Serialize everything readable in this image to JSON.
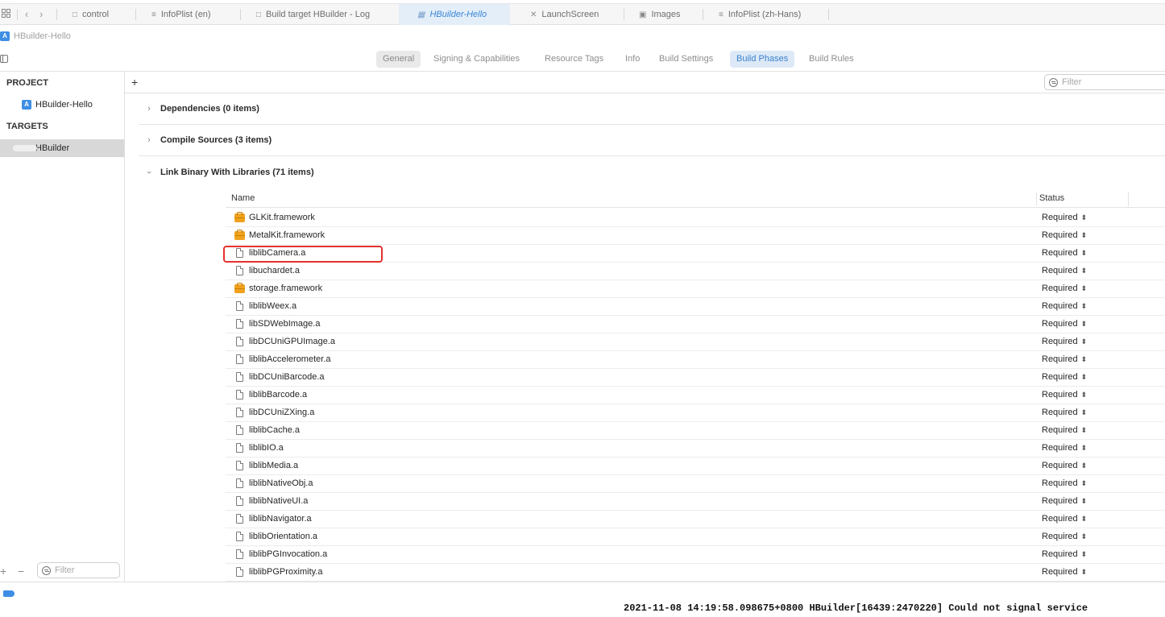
{
  "tabs": [
    {
      "label": "control",
      "icon": "file-icon"
    },
    {
      "label": "InfoPlist (en)",
      "icon": "strings-icon"
    },
    {
      "label": "Build target HBuilder - Log",
      "icon": "file-icon"
    },
    {
      "label": "HBuilder-Hello",
      "icon": "app-icon",
      "active": true
    },
    {
      "label": "LaunchScreen",
      "icon": "storyboard-icon"
    },
    {
      "label": "Images",
      "icon": "image-icon"
    },
    {
      "label": "InfoPlist (zh-Hans)",
      "icon": "strings-icon"
    }
  ],
  "breadcrumb": {
    "label": "HBuilder-Hello"
  },
  "editor_tabs": [
    "General",
    "Signing & Capabilities",
    "Resource Tags",
    "Info",
    "Build Settings",
    "Build Phases",
    "Build Rules"
  ],
  "editor_tab_selected": "Build Phases",
  "sidebar": {
    "project_header": "PROJECT",
    "project_item": "HBuilder-Hello",
    "targets_header": "TARGETS",
    "target_item": "HBuilder",
    "add_label": "+",
    "remove_label": "−",
    "filter_placeholder": "Filter"
  },
  "main": {
    "add_label": "+",
    "filter_placeholder": "Filter",
    "phases": [
      {
        "title": "Dependencies (0 items)",
        "expanded": false
      },
      {
        "title": "Compile Sources (3 items)",
        "expanded": false
      },
      {
        "title": "Link Binary With Libraries (71 items)",
        "expanded": true
      }
    ],
    "table_headers": {
      "name": "Name",
      "status": "Status"
    },
    "libraries": [
      {
        "name": "GLKit.framework",
        "status": "Required",
        "kind": "framework"
      },
      {
        "name": "MetalKit.framework",
        "status": "Required",
        "kind": "framework"
      },
      {
        "name": "liblibCamera.a",
        "status": "Required",
        "kind": "file",
        "highlighted": true
      },
      {
        "name": "libuchardet.a",
        "status": "Required",
        "kind": "file"
      },
      {
        "name": "storage.framework",
        "status": "Required",
        "kind": "framework"
      },
      {
        "name": "liblibWeex.a",
        "status": "Required",
        "kind": "file"
      },
      {
        "name": "libSDWebImage.a",
        "status": "Required",
        "kind": "file"
      },
      {
        "name": "libDCUniGPUImage.a",
        "status": "Required",
        "kind": "file"
      },
      {
        "name": "liblibAccelerometer.a",
        "status": "Required",
        "kind": "file"
      },
      {
        "name": "libDCUniBarcode.a",
        "status": "Required",
        "kind": "file"
      },
      {
        "name": "liblibBarcode.a",
        "status": "Required",
        "kind": "file"
      },
      {
        "name": "libDCUniZXing.a",
        "status": "Required",
        "kind": "file"
      },
      {
        "name": "liblibCache.a",
        "status": "Required",
        "kind": "file"
      },
      {
        "name": "liblibIO.a",
        "status": "Required",
        "kind": "file"
      },
      {
        "name": "liblibMedia.a",
        "status": "Required",
        "kind": "file"
      },
      {
        "name": "liblibNativeObj.a",
        "status": "Required",
        "kind": "file"
      },
      {
        "name": "liblibNativeUI.a",
        "status": "Required",
        "kind": "file"
      },
      {
        "name": "liblibNavigator.a",
        "status": "Required",
        "kind": "file"
      },
      {
        "name": "liblibOrientation.a",
        "status": "Required",
        "kind": "file"
      },
      {
        "name": "liblibPGInvocation.a",
        "status": "Required",
        "kind": "file"
      },
      {
        "name": "liblibPGProximity.a",
        "status": "Required",
        "kind": "file"
      }
    ]
  },
  "console": {
    "text": "2021-11-08 14:19:58.098675+0800 HBuilder[16439:2470220] Could not signal service"
  },
  "colors": {
    "accent": "#3c82d0",
    "highlight_box": "#e5312e",
    "framework_icon": "#f0a21e"
  }
}
